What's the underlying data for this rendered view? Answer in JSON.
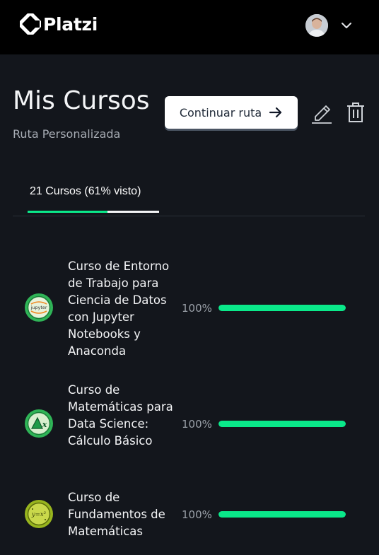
{
  "header": {
    "logo_text": "Platzi",
    "avatar_icon": "user-avatar",
    "menu_icon": "chevron-down-icon"
  },
  "page": {
    "title": "Mis Cursos",
    "subtitle": "Ruta Personalizada",
    "continue_label": "Continuar ruta",
    "continue_icon": "arrow-right-icon",
    "edit_icon": "pencil-icon",
    "delete_icon": "trash-icon"
  },
  "tab": {
    "label": "21 Cursos (61% visto)",
    "progress_fraction": 0.61
  },
  "courses": [
    {
      "title": "Curso de Entorno de Trabajo para Ciencia de Datos con Jupyter Notebooks y Anaconda",
      "percent_label": "100%",
      "progress": 1.0,
      "badge_icon": "jupyter-badge-icon",
      "badge_text": "jupyter",
      "badge_color": "#2fb457"
    },
    {
      "title": "Curso de Matemáticas para Data Science: Cálculo Básico",
      "percent_label": "100%",
      "progress": 1.0,
      "badge_icon": "calculus-badge-icon",
      "badge_text": "x",
      "badge_color": "#2fb457"
    },
    {
      "title": "Curso de Fundamentos de Matemáticas",
      "percent_label": "100%",
      "progress": 1.0,
      "badge_icon": "math-fundamentals-badge-icon",
      "badge_text": "y=x²",
      "badge_color": "#98b51e"
    }
  ],
  "colors": {
    "accent": "#0ae98a",
    "background": "#13161c",
    "topbar": "#000000"
  }
}
